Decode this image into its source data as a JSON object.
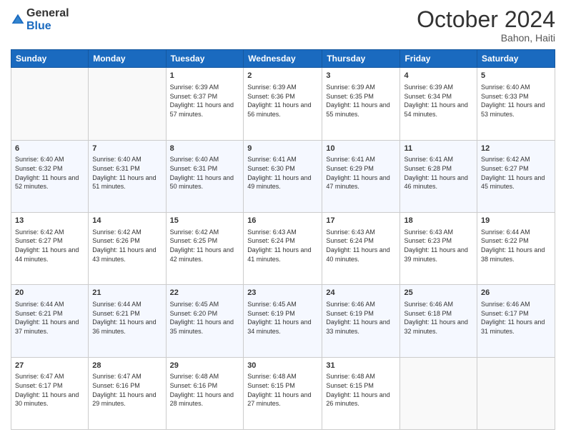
{
  "header": {
    "logo_line1": "General",
    "logo_line2": "Blue",
    "month": "October 2024",
    "location": "Bahon, Haiti"
  },
  "days_of_week": [
    "Sunday",
    "Monday",
    "Tuesday",
    "Wednesday",
    "Thursday",
    "Friday",
    "Saturday"
  ],
  "weeks": [
    [
      {
        "day": "",
        "info": ""
      },
      {
        "day": "",
        "info": ""
      },
      {
        "day": "1",
        "info": "Sunrise: 6:39 AM\nSunset: 6:37 PM\nDaylight: 11 hours and 57 minutes."
      },
      {
        "day": "2",
        "info": "Sunrise: 6:39 AM\nSunset: 6:36 PM\nDaylight: 11 hours and 56 minutes."
      },
      {
        "day": "3",
        "info": "Sunrise: 6:39 AM\nSunset: 6:35 PM\nDaylight: 11 hours and 55 minutes."
      },
      {
        "day": "4",
        "info": "Sunrise: 6:39 AM\nSunset: 6:34 PM\nDaylight: 11 hours and 54 minutes."
      },
      {
        "day": "5",
        "info": "Sunrise: 6:40 AM\nSunset: 6:33 PM\nDaylight: 11 hours and 53 minutes."
      }
    ],
    [
      {
        "day": "6",
        "info": "Sunrise: 6:40 AM\nSunset: 6:32 PM\nDaylight: 11 hours and 52 minutes."
      },
      {
        "day": "7",
        "info": "Sunrise: 6:40 AM\nSunset: 6:31 PM\nDaylight: 11 hours and 51 minutes."
      },
      {
        "day": "8",
        "info": "Sunrise: 6:40 AM\nSunset: 6:31 PM\nDaylight: 11 hours and 50 minutes."
      },
      {
        "day": "9",
        "info": "Sunrise: 6:41 AM\nSunset: 6:30 PM\nDaylight: 11 hours and 49 minutes."
      },
      {
        "day": "10",
        "info": "Sunrise: 6:41 AM\nSunset: 6:29 PM\nDaylight: 11 hours and 47 minutes."
      },
      {
        "day": "11",
        "info": "Sunrise: 6:41 AM\nSunset: 6:28 PM\nDaylight: 11 hours and 46 minutes."
      },
      {
        "day": "12",
        "info": "Sunrise: 6:42 AM\nSunset: 6:27 PM\nDaylight: 11 hours and 45 minutes."
      }
    ],
    [
      {
        "day": "13",
        "info": "Sunrise: 6:42 AM\nSunset: 6:27 PM\nDaylight: 11 hours and 44 minutes."
      },
      {
        "day": "14",
        "info": "Sunrise: 6:42 AM\nSunset: 6:26 PM\nDaylight: 11 hours and 43 minutes."
      },
      {
        "day": "15",
        "info": "Sunrise: 6:42 AM\nSunset: 6:25 PM\nDaylight: 11 hours and 42 minutes."
      },
      {
        "day": "16",
        "info": "Sunrise: 6:43 AM\nSunset: 6:24 PM\nDaylight: 11 hours and 41 minutes."
      },
      {
        "day": "17",
        "info": "Sunrise: 6:43 AM\nSunset: 6:24 PM\nDaylight: 11 hours and 40 minutes."
      },
      {
        "day": "18",
        "info": "Sunrise: 6:43 AM\nSunset: 6:23 PM\nDaylight: 11 hours and 39 minutes."
      },
      {
        "day": "19",
        "info": "Sunrise: 6:44 AM\nSunset: 6:22 PM\nDaylight: 11 hours and 38 minutes."
      }
    ],
    [
      {
        "day": "20",
        "info": "Sunrise: 6:44 AM\nSunset: 6:21 PM\nDaylight: 11 hours and 37 minutes."
      },
      {
        "day": "21",
        "info": "Sunrise: 6:44 AM\nSunset: 6:21 PM\nDaylight: 11 hours and 36 minutes."
      },
      {
        "day": "22",
        "info": "Sunrise: 6:45 AM\nSunset: 6:20 PM\nDaylight: 11 hours and 35 minutes."
      },
      {
        "day": "23",
        "info": "Sunrise: 6:45 AM\nSunset: 6:19 PM\nDaylight: 11 hours and 34 minutes."
      },
      {
        "day": "24",
        "info": "Sunrise: 6:46 AM\nSunset: 6:19 PM\nDaylight: 11 hours and 33 minutes."
      },
      {
        "day": "25",
        "info": "Sunrise: 6:46 AM\nSunset: 6:18 PM\nDaylight: 11 hours and 32 minutes."
      },
      {
        "day": "26",
        "info": "Sunrise: 6:46 AM\nSunset: 6:17 PM\nDaylight: 11 hours and 31 minutes."
      }
    ],
    [
      {
        "day": "27",
        "info": "Sunrise: 6:47 AM\nSunset: 6:17 PM\nDaylight: 11 hours and 30 minutes."
      },
      {
        "day": "28",
        "info": "Sunrise: 6:47 AM\nSunset: 6:16 PM\nDaylight: 11 hours and 29 minutes."
      },
      {
        "day": "29",
        "info": "Sunrise: 6:48 AM\nSunset: 6:16 PM\nDaylight: 11 hours and 28 minutes."
      },
      {
        "day": "30",
        "info": "Sunrise: 6:48 AM\nSunset: 6:15 PM\nDaylight: 11 hours and 27 minutes."
      },
      {
        "day": "31",
        "info": "Sunrise: 6:48 AM\nSunset: 6:15 PM\nDaylight: 11 hours and 26 minutes."
      },
      {
        "day": "",
        "info": ""
      },
      {
        "day": "",
        "info": ""
      }
    ]
  ]
}
